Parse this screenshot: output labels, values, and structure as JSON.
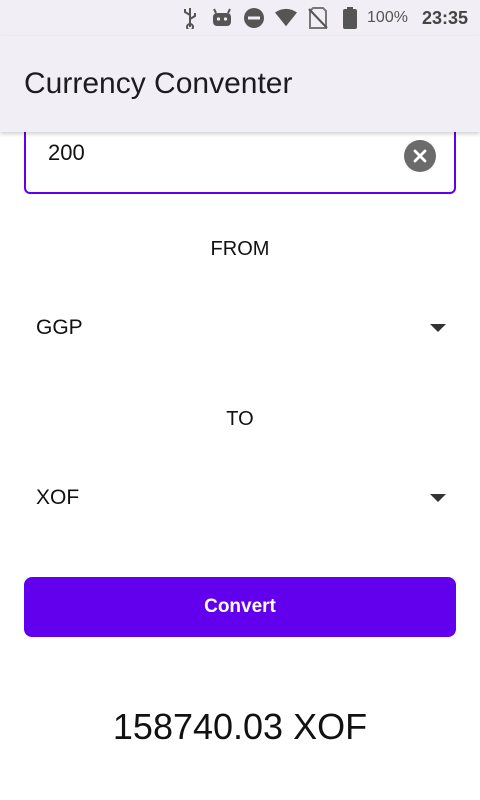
{
  "status_bar": {
    "battery_percent": "100%",
    "time": "23:35",
    "icons": [
      "usb-icon",
      "android-debug-icon",
      "do-not-disturb-icon",
      "wifi-icon",
      "no-sim-icon",
      "battery-icon"
    ]
  },
  "app_bar": {
    "title": "Currency Conventer"
  },
  "amount_input": {
    "value": "200"
  },
  "from": {
    "label": "FROM",
    "selected": "GGP"
  },
  "to": {
    "label": "TO",
    "selected": "XOF"
  },
  "convert_button": {
    "label": "Convert"
  },
  "result": {
    "text": "158740.03 XOF"
  },
  "colors": {
    "accent": "#6200ee",
    "app_bar_bg": "#f2eef6"
  }
}
